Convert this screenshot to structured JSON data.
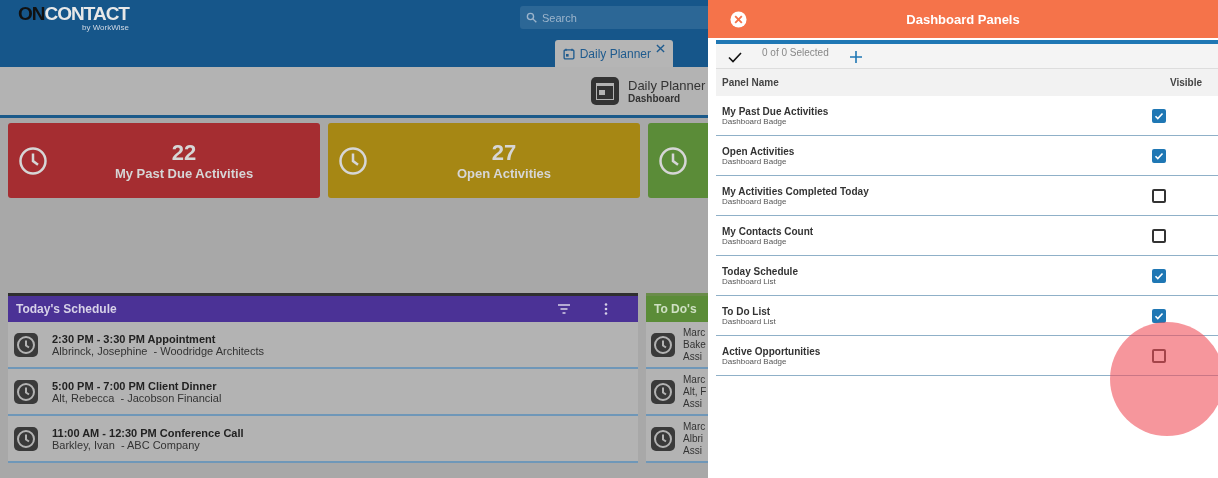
{
  "app_header": {
    "logo": {
      "brand_bold": "ON",
      "brand": "CONTACT",
      "tagline": "by WorkWise"
    },
    "search": {
      "placeholder": "Search"
    },
    "tabs": [
      {
        "label": "Daily Planner",
        "selected": true
      }
    ]
  },
  "page_header": {
    "title": "Daily Planner",
    "subtitle": "Dashboard"
  },
  "badges": [
    {
      "count": "22",
      "label": "My Past Due Activities",
      "color": "#a52d31"
    },
    {
      "count": "27",
      "label": "Open Activities",
      "color": "#a68714"
    },
    {
      "color": "#5b8c38"
    }
  ],
  "schedule": {
    "title": "Today's Schedule",
    "items": [
      {
        "title": "2:30 PM - 3:30 PM Appointment",
        "subtitle": "Albrinck, Josephine  - Woodridge Architects"
      },
      {
        "title": "5:00 PM - 7:00 PM Client Dinner",
        "subtitle": "Alt, Rebecca  - Jacobson Financial"
      },
      {
        "title": "11:00 AM - 12:30 PM Conference Call",
        "subtitle": "Barkley, Ivan  - ABC Company"
      }
    ]
  },
  "todos": {
    "title": "To Do's",
    "items": [
      {
        "lines": [
          "Marc",
          "Bake",
          "Assi"
        ]
      },
      {
        "lines": [
          "Marc",
          "Alt, F",
          "Assi"
        ]
      },
      {
        "lines": [
          "Marc",
          "Albri",
          "Assi"
        ]
      }
    ]
  },
  "drawer": {
    "title": "Dashboard Panels",
    "selection": "0 of 0 Selected",
    "columns": [
      "Panel Name",
      "Visible"
    ],
    "rows": [
      {
        "name": "My Past Due Activities",
        "type": "Dashboard Badge",
        "visible": true
      },
      {
        "name": "Open Activities",
        "type": "Dashboard Badge",
        "visible": true
      },
      {
        "name": "My Activities Completed Today",
        "type": "Dashboard Badge",
        "visible": false
      },
      {
        "name": "My Contacts Count",
        "type": "Dashboard Badge",
        "visible": false
      },
      {
        "name": "Today Schedule",
        "type": "Dashboard List",
        "visible": true
      },
      {
        "name": "To Do List",
        "type": "Dashboard List",
        "visible": true
      },
      {
        "name": "Active Opportunities",
        "type": "Dashboard Badge",
        "visible": false
      }
    ]
  }
}
